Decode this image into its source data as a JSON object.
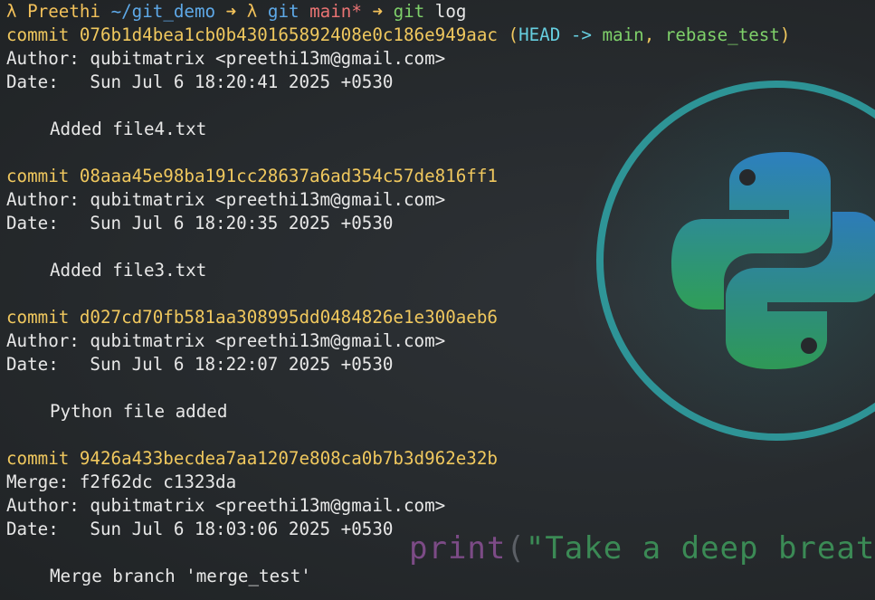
{
  "colors": {
    "background": "#26292c",
    "prompt": "#f2c15a",
    "path": "#5ea9e8",
    "branch": "#ea7373",
    "command": "#7fd16a",
    "commit_hash": "#f0c85e",
    "head_ref": "#66cfe0",
    "logo_ring": "#2fa6a8",
    "logo_gradient_top": "#2d7fbf",
    "logo_gradient_bottom": "#2f9e57"
  },
  "prompt": {
    "lambda": "λ",
    "user": "Preethi",
    "path": "~/git_demo",
    "arrow": "➜",
    "lambda2": "λ",
    "git_label": "git",
    "branch": "main*",
    "arrow2": "➜",
    "command": "git",
    "args": "log"
  },
  "commits": [
    {
      "label": "commit",
      "hash": "076b1d4bea1cb0b430165892408e0c186e949aac",
      "refs_open": "(",
      "ref_head": "HEAD -> ",
      "ref_main": "main",
      "ref_sep": ", ",
      "ref_other": "rebase_test",
      "refs_close": ")",
      "author": "Author: qubitmatrix <preethi13m@gmail.com>",
      "date": "Date:   Sun Jul 6 18:20:41 2025 +0530",
      "message": "Added file4.txt"
    },
    {
      "label": "commit",
      "hash": "08aaa45e98ba191cc28637a6ad354c57de816ff1",
      "author": "Author: qubitmatrix <preethi13m@gmail.com>",
      "date": "Date:   Sun Jul 6 18:20:35 2025 +0530",
      "message": "Added file3.txt"
    },
    {
      "label": "commit",
      "hash": "d027cd70fb581aa308995dd0484826e1e300aeb6",
      "author": "Author: qubitmatrix <preethi13m@gmail.com>",
      "date": "Date:   Sun Jul 6 18:22:07 2025 +0530",
      "message": "Python file added"
    },
    {
      "label": "commit",
      "hash": "9426a433becdea7aa1207e808ca0b7b3d962e32b",
      "merge": "Merge: f2f62dc c1323da",
      "author": "Author: qubitmatrix <preethi13m@gmail.com>",
      "date": "Date:   Sun Jul 6 18:03:06 2025 +0530",
      "message": "Merge branch 'merge_test'"
    }
  ],
  "wallpaper": {
    "logo": "python-logo-icon",
    "code_keyword": "print",
    "code_paren": "(",
    "code_string": "\"Take a deep breath"
  }
}
